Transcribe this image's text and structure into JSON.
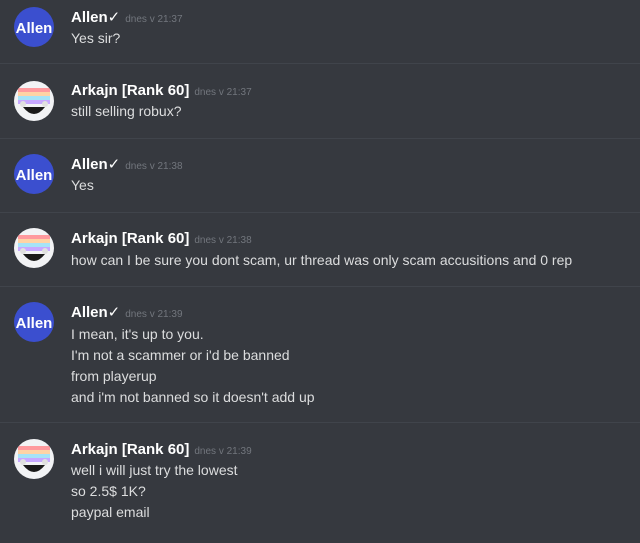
{
  "colors": {
    "background": "#36393f",
    "divider": "#40444b",
    "username": "#ffffff",
    "timestamp": "#72767d",
    "message_text": "#dcddde",
    "allen_avatar_bg": "#3b4fcf"
  },
  "messages": [
    {
      "author": "Allen✓",
      "avatar": "allen-avatar-icon",
      "avatar_text": "Allen",
      "timestamp": "dnes v 21:37",
      "lines": [
        "Yes sir?"
      ]
    },
    {
      "author": "Arkajn [Rank 60]",
      "avatar": "arkajn-avatar-icon",
      "timestamp": "dnes v 21:37",
      "lines": [
        "still selling robux?"
      ]
    },
    {
      "author": "Allen✓",
      "avatar": "allen-avatar-icon",
      "avatar_text": "Allen",
      "timestamp": "dnes v 21:38",
      "lines": [
        "Yes"
      ]
    },
    {
      "author": "Arkajn [Rank 60]",
      "avatar": "arkajn-avatar-icon",
      "timestamp": "dnes v 21:38",
      "lines": [
        "how can I be sure you dont scam, ur thread was only scam accusitions and 0 rep"
      ]
    },
    {
      "author": "Allen✓",
      "avatar": "allen-avatar-icon",
      "avatar_text": "Allen",
      "timestamp": "dnes v 21:39",
      "lines": [
        "I mean, it's up to you.",
        "I'm not a scammer or i'd be banned",
        "from playerup",
        "and i'm not banned so it doesn't add up"
      ]
    },
    {
      "author": "Arkajn [Rank 60]",
      "avatar": "arkajn-avatar-icon",
      "timestamp": "dnes v 21:39",
      "lines": [
        "well i will just try the lowest",
        "so 2.5$ 1K?",
        "paypal email"
      ]
    }
  ]
}
